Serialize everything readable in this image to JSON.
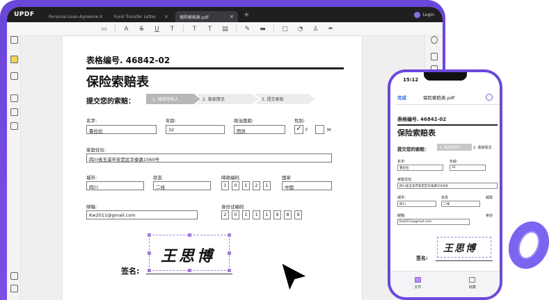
{
  "app": {
    "logo": "UPDF",
    "login": "Login"
  },
  "tabs": [
    {
      "label": "Personal-Loan-Agreeme",
      "close": "×"
    },
    {
      "label": "Fund Transfer Letter",
      "close": "×"
    },
    {
      "label": "保险索赔表.pdf",
      "close": "×"
    }
  ],
  "new_tab": "+",
  "toolbar": {
    "t1": "A",
    "t2": "S",
    "t3": "U",
    "t4": "T",
    "t5": "T",
    "t6": "T"
  },
  "doc": {
    "form_no": "表格编号. 46842-02",
    "title": "保险索赔表",
    "submit_label": "提交您的索赔：",
    "steps": [
      "1. 保单持有人",
      "2. 事故情况",
      "3. 提交索赔"
    ],
    "name": {
      "label": "名字:",
      "value": "鲁拉拉"
    },
    "age": {
      "label": "年龄:",
      "value": "32"
    },
    "politics": {
      "label": "政治面貌:",
      "value": "团员"
    },
    "gender": {
      "label": "性别:",
      "f": "F",
      "m": "M",
      "check": "✓"
    },
    "address": {
      "label": "家庭住址:",
      "value": "四川省玉溪市安定区华泰路1560号"
    },
    "city": {
      "label": "城市:",
      "value": "四川"
    },
    "state": {
      "label": "状态",
      "value": "二线"
    },
    "postcode": {
      "label": "邮政编码",
      "digits": [
        "1",
        "0",
        "1",
        "2",
        "1"
      ]
    },
    "country": {
      "label": "国家",
      "value": "中国"
    },
    "email": {
      "label": "邮箱:",
      "value": "Kw2011@gmail.com"
    },
    "id": {
      "label": "身份证编码",
      "digits": [
        "2",
        "0",
        "1",
        "1",
        "1",
        "9",
        "8",
        "9"
      ]
    },
    "signature_text": "王思博",
    "signature_label": "签名:"
  },
  "phone": {
    "time": "15:12",
    "done": "完成",
    "filename": "保险索赔表.pdf",
    "form_no": "表格编号. 46842-02",
    "title": "保险索赔表",
    "submit_label": "提交您的索赔：",
    "steps": [
      "1. 保单持有人",
      "2. 事故情况"
    ],
    "name_label": "名字:",
    "name_value": "鲁拉拉",
    "age_label": "年龄:",
    "age_value": "32",
    "address_label": "家庭住址:",
    "address_value": "四川省玉溪市安定区华泰路1560号",
    "city_label": "城市:",
    "city_value": "四川",
    "state_label": "状态",
    "state_value": "二线",
    "postcode_label": "邮政",
    "email_label": "邮箱:",
    "email_value": "Kw2011@gmail.com",
    "id_label": "身份",
    "signature_text": "王思博",
    "signature_label": "签名:",
    "footer": [
      "文件",
      "收藏"
    ]
  }
}
